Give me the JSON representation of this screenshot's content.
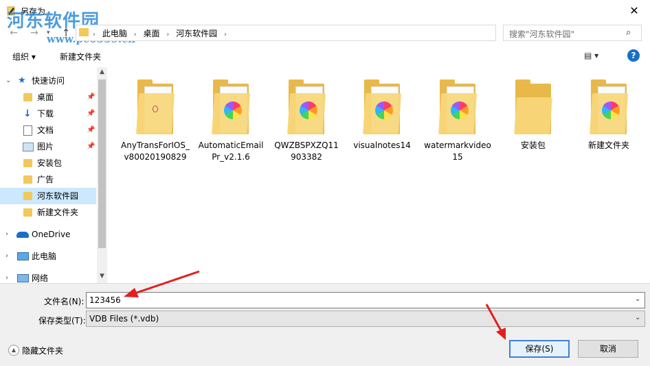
{
  "window": {
    "title": "另存为",
    "watermark": "河东软件园",
    "watermark_url": "www.pc0359.cn",
    "close_glyph": "✕"
  },
  "address_bar": {
    "crumbs": [
      "此电脑",
      "桌面",
      "河东软件园"
    ]
  },
  "search": {
    "placeholder": "搜索\"河东软件园\""
  },
  "toolbar": {
    "organize": "组织 ▾",
    "new_folder": "新建文件夹",
    "view_glyph": "▤ ▾",
    "help_glyph": "?"
  },
  "nav": {
    "quick_access": "快速访问",
    "quick_items": [
      {
        "label": "桌面",
        "icon": "folder-icon",
        "pinned": true
      },
      {
        "label": "下载",
        "icon": "download-icon",
        "pinned": true
      },
      {
        "label": "文档",
        "icon": "document-icon",
        "pinned": true
      },
      {
        "label": "图片",
        "icon": "picture-icon",
        "pinned": true
      },
      {
        "label": "安装包",
        "icon": "folder-icon",
        "pinned": false
      },
      {
        "label": "广告",
        "icon": "folder-icon",
        "pinned": false
      },
      {
        "label": "河东软件园",
        "icon": "folder-icon",
        "pinned": false,
        "selected": true
      },
      {
        "label": "新建文件夹",
        "icon": "folder-icon",
        "pinned": false
      }
    ],
    "onedrive": "OneDrive",
    "this_pc": "此电脑",
    "network": "网络"
  },
  "files": [
    {
      "name": "AnyTransForIOS_v80020190829",
      "icon": "folder-with-document-icon"
    },
    {
      "name": "AutomaticEmailPr_v2.1.6",
      "icon": "folder-with-app-icon"
    },
    {
      "name": "QWZBSPXZQ11903382",
      "icon": "folder-with-app-icon"
    },
    {
      "name": "visualnotes14",
      "icon": "folder-with-app-icon"
    },
    {
      "name": "watermarkvideo15",
      "icon": "folder-with-app-icon"
    },
    {
      "name": "安装包",
      "icon": "folder-icon"
    },
    {
      "name": "新建文件夹",
      "icon": "folder-with-app-icon"
    }
  ],
  "bottom": {
    "filename_label": "文件名(N):",
    "filename_value": "123456",
    "filetype_label": "保存类型(T):",
    "filetype_value": "VDB Files (*.vdb)",
    "hide_folders": "隐藏文件夹",
    "save": "保存(S)",
    "cancel": "取消"
  },
  "colors": {
    "accent": "#3c7fd8",
    "selection": "#cce8ff",
    "annotation": "#e02020",
    "folder": "#f0c95a"
  }
}
